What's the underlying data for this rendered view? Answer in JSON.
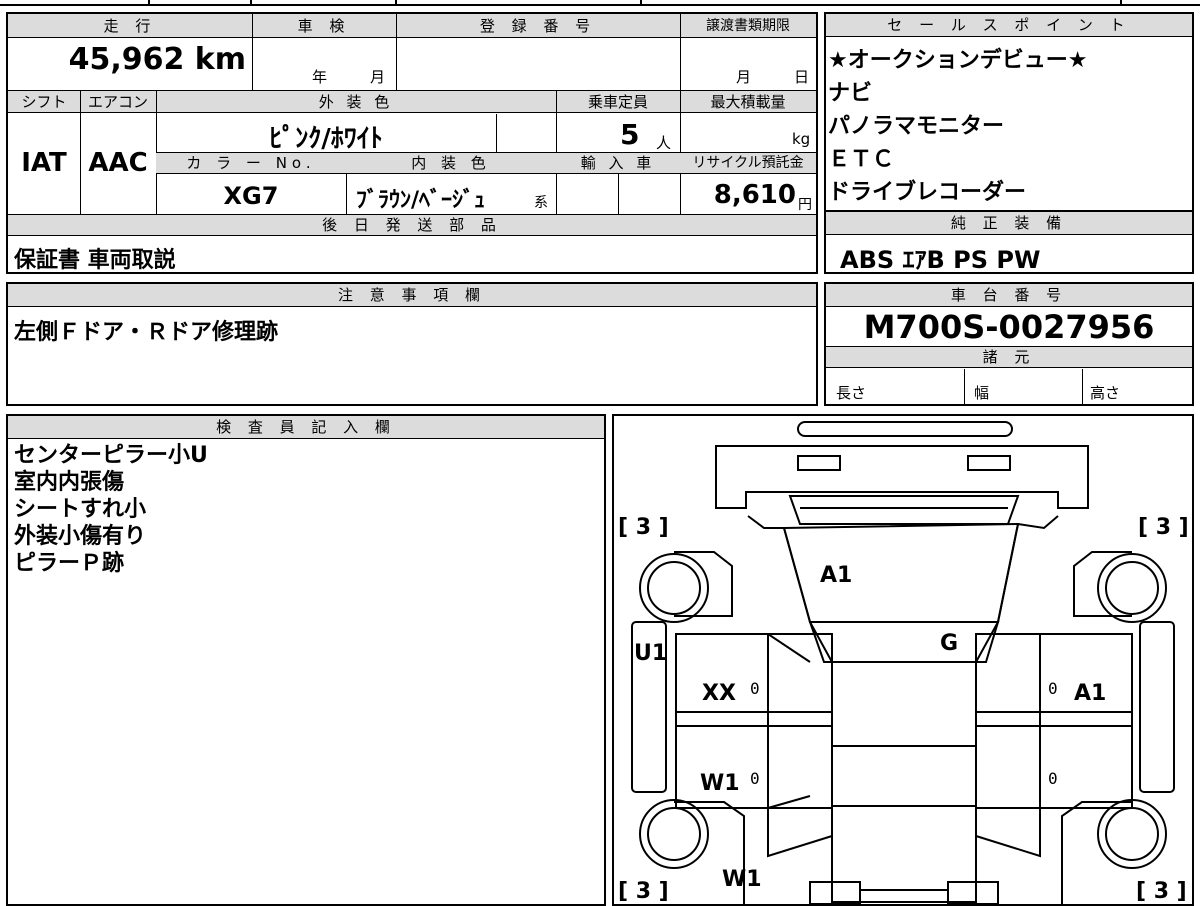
{
  "vehicle": {
    "mileage_label": "走 行",
    "mileage": "45,962 km",
    "inspection_label": "車 検",
    "inspection_year": "年",
    "inspection_month": "月",
    "reg_label": "登 録 番 号",
    "doc_deadline_label": "譲渡書類期限",
    "doc_month": "月",
    "doc_day": "日",
    "shift_label": "シフト",
    "shift": "IAT",
    "ac_label": "エアコン",
    "ac": "AAC",
    "exterior_label": "外 装 色",
    "exterior": "ﾋﾟﾝｸ/ﾎﾜｲﾄ",
    "capacity_label": "乗車定員",
    "capacity": "5",
    "capacity_unit": "人",
    "max_load_label": "最大積載量",
    "max_load_unit": "kg",
    "color_no_label": "カ ラ ー No.",
    "color_no": "XG7",
    "interior_label": "内 装 色",
    "interior": "ﾌﾞﾗｳﾝ/ﾍﾞｰｼﾞｭ",
    "interior_suffix": "系",
    "import_label": "輸 入 車",
    "recycle_label": "リサイクル預託金",
    "recycle": "8,610",
    "recycle_unit": "円"
  },
  "later_parts": {
    "label": "後 日 発 送 部 品",
    "value": "保証書 車両取説"
  },
  "notes": {
    "label": "注 意 事 項 欄",
    "value": "左側Ｆドア・Ｒドア修理跡"
  },
  "sales": {
    "label": "セ ー ル ス ポ イ ン ト",
    "items": [
      "★オークションデビュー★",
      "ナビ",
      "パノラマモニター",
      "ＥＴＣ",
      "ドライブレコーダー"
    ]
  },
  "equipment": {
    "label": "純 正 装 備",
    "value": "ABS ｴｱB PS PW"
  },
  "chassis": {
    "label": "車 台 番 号",
    "value": "M700S-0027956"
  },
  "specs": {
    "label": "諸 元",
    "length": "長さ",
    "width": "幅",
    "height": "高さ"
  },
  "inspector": {
    "label": "検 査 員 記 入 欄",
    "lines": [
      "センターピラー小U",
      "室内内張傷",
      "シートすれ小",
      "外装小傷有り",
      "ピラーＰ跡"
    ]
  },
  "diagram": {
    "marks": {
      "A1_top": "A1",
      "G": "G",
      "U1": "U1",
      "XX": "XX",
      "A1_right": "A1",
      "W1_left": "W1",
      "W1_bottom": "W1"
    },
    "tires": {
      "fl": "[ 3 ]",
      "fr": "[ 3 ]",
      "rl": "[ 3 ]",
      "rr": "[ 3 ]"
    },
    "zeros": [
      "0",
      "0",
      "0",
      "0"
    ]
  }
}
